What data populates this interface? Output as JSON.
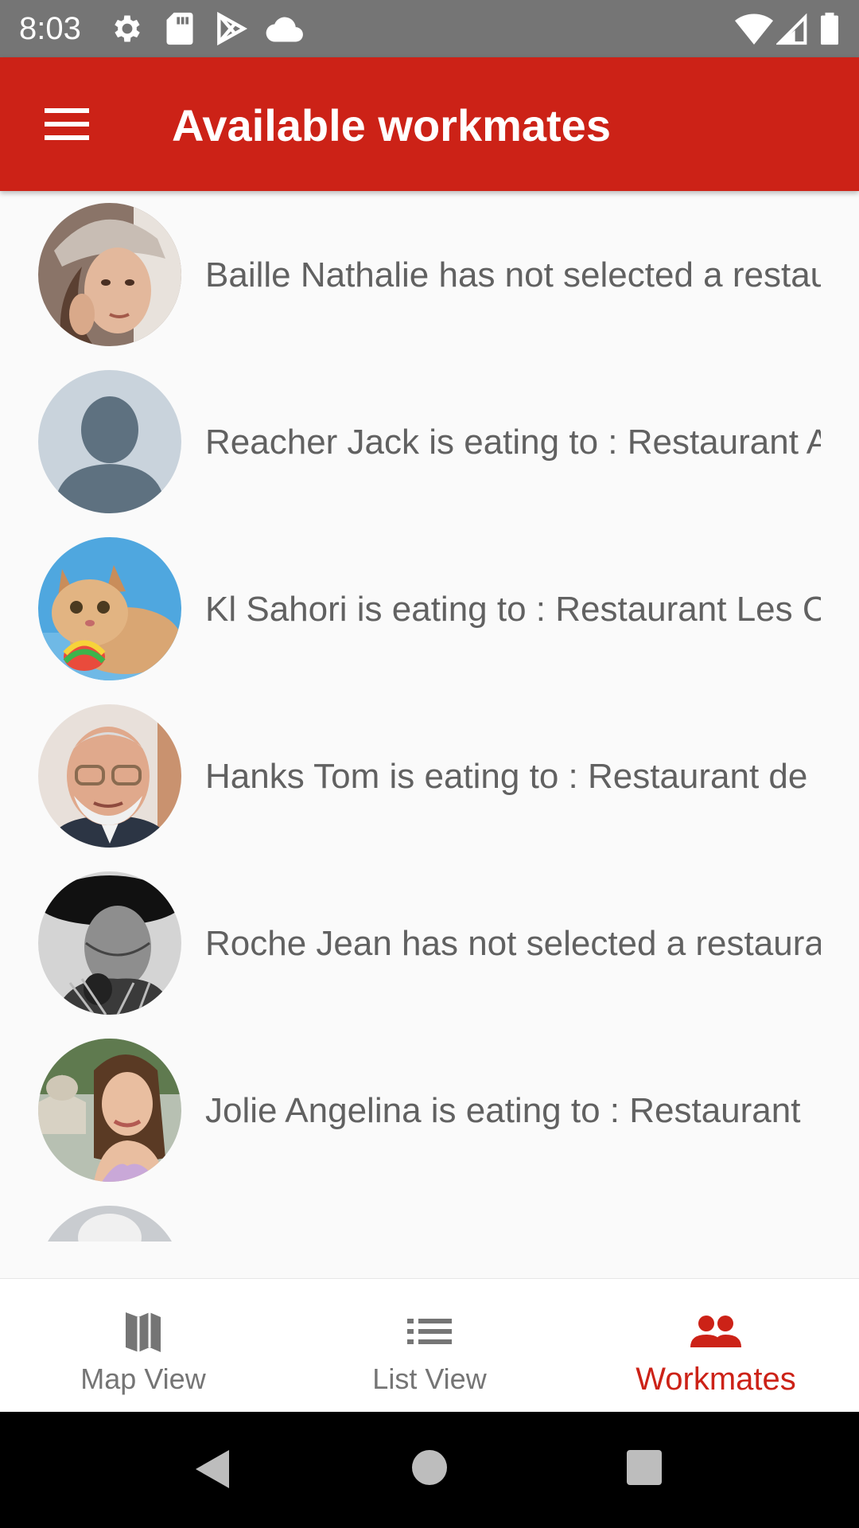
{
  "status_bar": {
    "time": "8:03",
    "left_icons": [
      "gear-icon",
      "sd-card-icon",
      "play-store-icon",
      "cloud-icon"
    ],
    "right_icons": [
      "wifi-icon",
      "cell-signal-icon",
      "battery-icon"
    ]
  },
  "app_bar": {
    "title": "Available workmates",
    "menu_icon": "hamburger-menu-icon",
    "color": "#cc2217"
  },
  "workmates": [
    {
      "text": "Baille Nathalie has not selected a restaurant yet",
      "avatar": "woman-cap-photo"
    },
    {
      "text": "Reacher Jack is eating to : Restaurant A",
      "avatar": "default-person-placeholder"
    },
    {
      "text": "Kl Sahori is eating to : Restaurant Les C",
      "avatar": "kitten-photo"
    },
    {
      "text": "Hanks Tom is eating to : Restaurant de",
      "avatar": "man-glasses-photo"
    },
    {
      "text": "Roche Jean has not selected a restaurant yet",
      "avatar": "man-black-hat-photo"
    },
    {
      "text": "Jolie Angelina is eating to : Restaurant",
      "avatar": "woman-city-photo"
    }
  ],
  "bottom_nav": {
    "items": [
      {
        "label": "Map View",
        "icon": "map-icon",
        "active": false
      },
      {
        "label": "List View",
        "icon": "list-icon",
        "active": false
      },
      {
        "label": "Workmates",
        "icon": "people-icon",
        "active": true
      }
    ],
    "active_color": "#cc2217",
    "inactive_color": "#757575"
  },
  "system_nav": {
    "buttons": [
      "back-button",
      "home-button",
      "recents-button"
    ]
  }
}
